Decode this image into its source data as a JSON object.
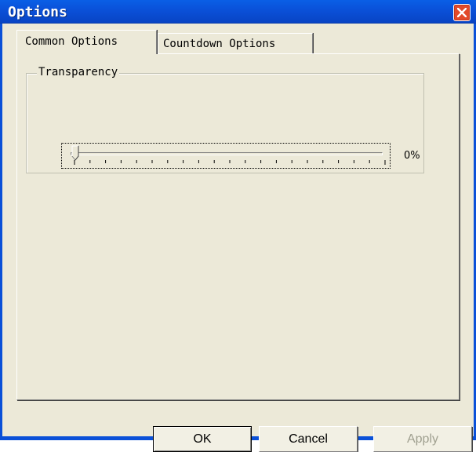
{
  "window": {
    "title": "Options",
    "close_icon": "close-icon"
  },
  "tabs": [
    {
      "label": "Common Options",
      "active": true
    },
    {
      "label": "Countdown Options",
      "active": false
    }
  ],
  "transparency": {
    "group_label": "Transparency",
    "value_label": "0%",
    "value": 0
  },
  "buttons": {
    "ok_label": "OK",
    "cancel_label": "Cancel",
    "apply_label": "Apply",
    "apply_enabled": false
  },
  "colors": {
    "titlebar": "#0a50d8",
    "close": "#e24a2a",
    "face": "#ece9d8"
  }
}
